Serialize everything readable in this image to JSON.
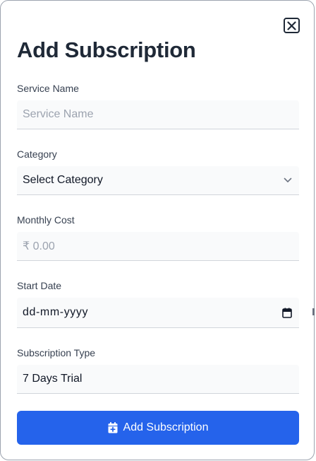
{
  "modal": {
    "title": "Add Subscription",
    "close_icon": "close-icon"
  },
  "fields": {
    "service_name": {
      "label": "Service Name",
      "placeholder": "Service Name"
    },
    "category": {
      "label": "Category",
      "selected": "Select Category",
      "icon": "chevron-down-icon"
    },
    "monthly_cost": {
      "label": "Monthly Cost",
      "placeholder": "₹ 0.00"
    },
    "start_date": {
      "label": "Start Date",
      "placeholder": "dd-mm-yyyy",
      "icon": "calendar-icon"
    },
    "subscription_type": {
      "label": "Subscription Type",
      "value": "7 Days Trial"
    }
  },
  "submit": {
    "label": "Add Subscription",
    "icon": "calendar-plus-icon"
  },
  "colors": {
    "accent": "#2563eb",
    "field_bg": "#f9fafb",
    "title": "#1f2937",
    "placeholder": "#9ca3af"
  }
}
